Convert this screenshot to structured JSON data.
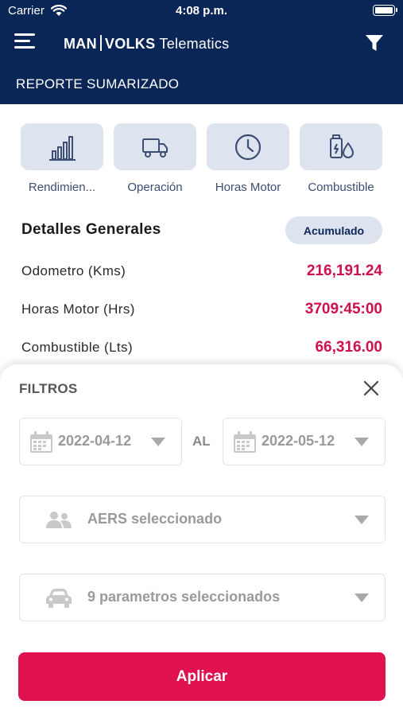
{
  "status_bar": {
    "carrier": "Carrier",
    "time": "4:08 p.m."
  },
  "header": {
    "brand_man": "MAN",
    "brand_volks": "VOLKS",
    "brand_telematics": "Telematics",
    "report_title": "REPORTE SUMARIZADO"
  },
  "categories": [
    {
      "label": "Rendimien...",
      "icon": "bar-chart-icon"
    },
    {
      "label": "Operación",
      "icon": "truck-icon"
    },
    {
      "label": "Horas Motor",
      "icon": "clock-icon"
    },
    {
      "label": "Combustible",
      "icon": "fuel-icon"
    }
  ],
  "details": {
    "title": "Detalles Generales",
    "mode_label": "Acumulado",
    "rows": [
      {
        "label": "Odometro (Kms)",
        "value": "216,191.24"
      },
      {
        "label": "Horas Motor (Hrs)",
        "value": "3709:45:00"
      },
      {
        "label": "Combustible (Lts)",
        "value": "66,316.00"
      }
    ]
  },
  "filters": {
    "title": "FILTROS",
    "date_from": "2022-04-12",
    "date_separator": "AL",
    "date_to": "2022-05-12",
    "aers": "AERS seleccionado",
    "parameters": "9 parametros seleccionados",
    "apply_label": "Aplicar"
  },
  "colors": {
    "header_bg": "#0a2656",
    "accent_red": "#e0114f",
    "value_red": "#d0104a",
    "chip_bg": "#dde3ef"
  }
}
